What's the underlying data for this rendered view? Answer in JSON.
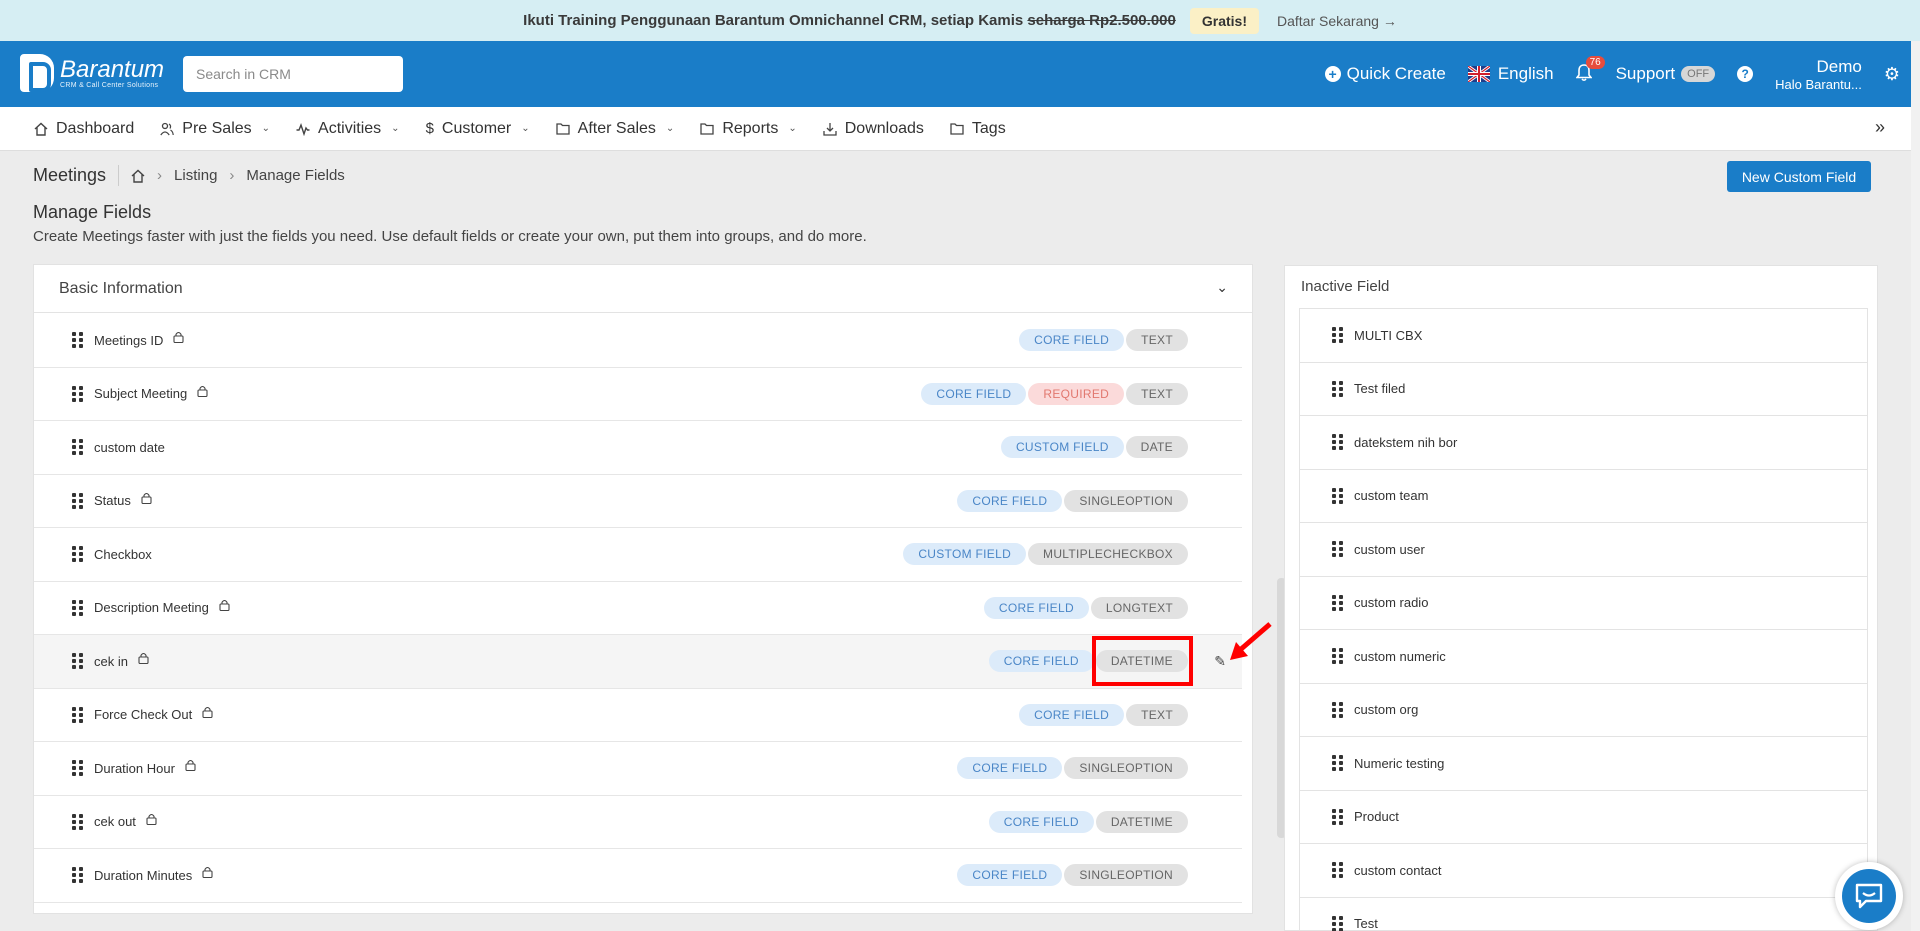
{
  "promo": {
    "text": "Ikuti Training Penggunaan Barantum Omnichannel CRM, setiap Kamis ",
    "strike": "seharga Rp2.500.000",
    "badge": "Gratis!",
    "cta": "Daftar Sekarang →"
  },
  "header": {
    "logo_name": "Barantum",
    "logo_sub": "CRM & Call Center Solutions",
    "search_placeholder": "Search in CRM",
    "quick_create": "Quick Create",
    "language": "English",
    "notif_count": "76",
    "support": "Support",
    "support_toggle": "OFF",
    "user_name": "Demo",
    "user_sub": "Halo Barantu..."
  },
  "nav": {
    "items": [
      {
        "label": "Dashboard",
        "icon": "home-icon",
        "has_menu": false
      },
      {
        "label": "Pre Sales",
        "icon": "users-icon",
        "has_menu": true
      },
      {
        "label": "Activities",
        "icon": "activity-icon",
        "has_menu": true
      },
      {
        "label": "Customer",
        "icon": "dollar-icon",
        "has_menu": true
      },
      {
        "label": "After Sales",
        "icon": "folder-icon",
        "has_menu": true
      },
      {
        "label": "Reports",
        "icon": "folder-icon",
        "has_menu": true
      },
      {
        "label": "Downloads",
        "icon": "download-icon",
        "has_menu": false
      },
      {
        "label": "Tags",
        "icon": "folder-icon",
        "has_menu": false
      }
    ]
  },
  "breadcrumb": {
    "module": "Meetings",
    "listing": "Listing",
    "current": "Manage Fields"
  },
  "new_button": "New Custom Field",
  "page": {
    "title": "Manage Fields",
    "description": "Create Meetings faster with just the fields you need. Use default fields or create your own, put them into groups, and do more."
  },
  "basic": {
    "title": "Basic Information",
    "fields": [
      {
        "name": "Meetings ID",
        "locked": true,
        "tags": [
          "CORE FIELD",
          "TEXT"
        ]
      },
      {
        "name": "Subject Meeting",
        "locked": true,
        "tags": [
          "CORE FIELD",
          "REQUIRED",
          "TEXT"
        ]
      },
      {
        "name": "custom date",
        "locked": false,
        "tags": [
          "CUSTOM FIELD",
          "DATE"
        ]
      },
      {
        "name": "Status",
        "locked": true,
        "tags": [
          "CORE FIELD",
          "SINGLEOPTION"
        ]
      },
      {
        "name": "Checkbox",
        "locked": false,
        "tags": [
          "CUSTOM FIELD",
          "MULTIPLECHECKBOX"
        ]
      },
      {
        "name": "Description Meeting",
        "locked": true,
        "tags": [
          "CORE FIELD",
          "LONGTEXT"
        ]
      },
      {
        "name": "cek in",
        "locked": true,
        "tags": [
          "CORE FIELD",
          "DATETIME"
        ],
        "highlighted": true
      },
      {
        "name": "Force Check Out",
        "locked": true,
        "tags": [
          "CORE FIELD",
          "TEXT"
        ]
      },
      {
        "name": "Duration Hour",
        "locked": true,
        "tags": [
          "CORE FIELD",
          "SINGLEOPTION"
        ]
      },
      {
        "name": "cek out",
        "locked": true,
        "tags": [
          "CORE FIELD",
          "DATETIME"
        ]
      },
      {
        "name": "Duration Minutes",
        "locked": true,
        "tags": [
          "CORE FIELD",
          "SINGLEOPTION"
        ]
      }
    ]
  },
  "inactive": {
    "title": "Inactive Field",
    "fields": [
      "MULTI CBX",
      "Test filed",
      "datekstem nih bor",
      "custom team",
      "custom user",
      "custom radio",
      "custom numeric",
      "custom org",
      "Numeric testing",
      "Product",
      "custom contact",
      "Test"
    ]
  },
  "colors": {
    "brand": "#1a7dc8",
    "highlight": "#ff0000"
  }
}
